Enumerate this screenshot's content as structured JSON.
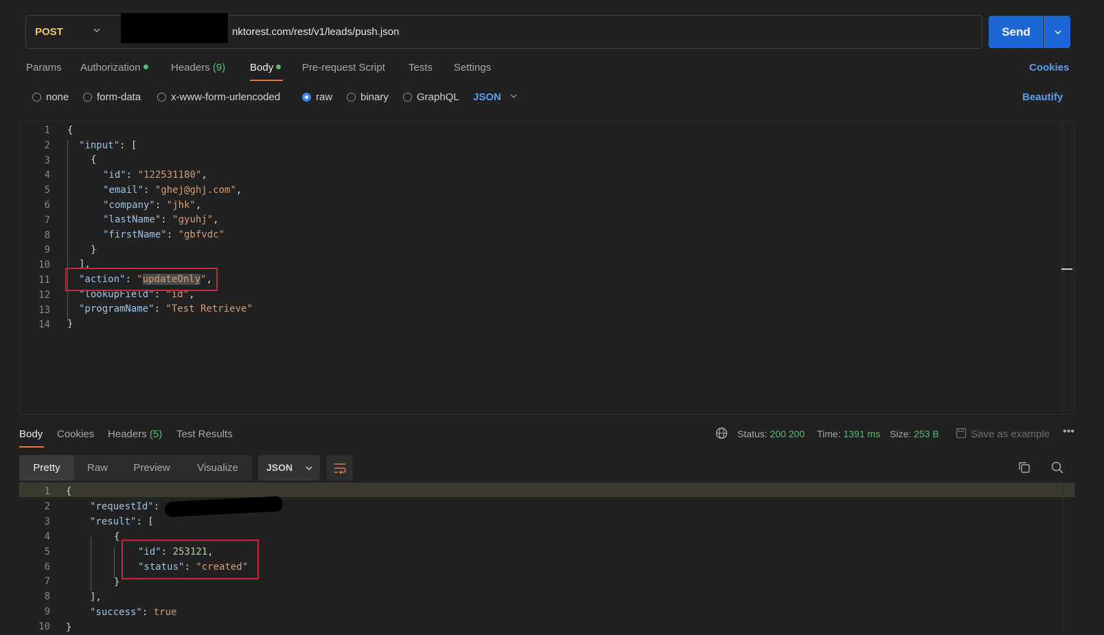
{
  "request": {
    "method": "POST",
    "url_visible": "nktorest.com/rest/v1/leads/push.json",
    "send_label": "Send"
  },
  "tabs": {
    "params": "Params",
    "authorization": "Authorization",
    "headers": "Headers",
    "headers_count": "(9)",
    "body": "Body",
    "prerequest": "Pre-request Script",
    "tests": "Tests",
    "settings": "Settings",
    "cookies": "Cookies"
  },
  "body_types": {
    "none": "none",
    "form_data": "form-data",
    "urlencoded": "x-www-form-urlencoded",
    "raw": "raw",
    "binary": "binary",
    "graphql": "GraphQL",
    "language": "JSON",
    "beautify": "Beautify"
  },
  "request_body": {
    "line_numbers": [
      "1",
      "2",
      "3",
      "4",
      "5",
      "6",
      "7",
      "8",
      "9",
      "10",
      "11",
      "12",
      "13",
      "14"
    ],
    "input_key": "\"input\"",
    "id_key": "\"id\"",
    "id_val": "\"122531180\"",
    "email_key": "\"email\"",
    "email_val": "\"ghej@ghj.com\"",
    "company_key": "\"company\"",
    "company_val": "\"jhk\"",
    "lastname_key": "\"lastName\"",
    "lastname_val": "\"gyuhj\"",
    "firstname_key": "\"firstName\"",
    "firstname_val": "\"gbfvdc\"",
    "action_key": "\"action\"",
    "action_val": "updateOnly",
    "lookup_key": "\"lookupField\"",
    "lookup_val": "\"id\"",
    "program_key": "\"programName\"",
    "program_val": "\"Test Retrieve\""
  },
  "response": {
    "tabs": {
      "body": "Body",
      "cookies": "Cookies",
      "headers": "Headers",
      "headers_count": "(5)",
      "test_results": "Test Results"
    },
    "status_label": "Status:",
    "status_value": "200 200",
    "time_label": "Time:",
    "time_value": "1391 ms",
    "size_label": "Size:",
    "size_value": "253 B",
    "save_example": "Save as example",
    "views": {
      "pretty": "Pretty",
      "raw": "Raw",
      "preview": "Preview",
      "visualize": "Visualize"
    },
    "format": "JSON",
    "line_numbers": [
      "1",
      "2",
      "3",
      "4",
      "5",
      "6",
      "7",
      "8",
      "9",
      "10"
    ],
    "request_id_key": "\"requestId\"",
    "result_key": "\"result\"",
    "id_key": "\"id\"",
    "id_val": "253121",
    "status_key": "\"status\"",
    "status_val": "\"created\"",
    "success_key": "\"success\"",
    "success_val": "true"
  },
  "colors": {
    "accent": "#1d66d6",
    "method": "#f4ca60",
    "highlight_box": "#c92537",
    "tab_underline": "#e5763f",
    "ok": "#4fbf6f"
  }
}
